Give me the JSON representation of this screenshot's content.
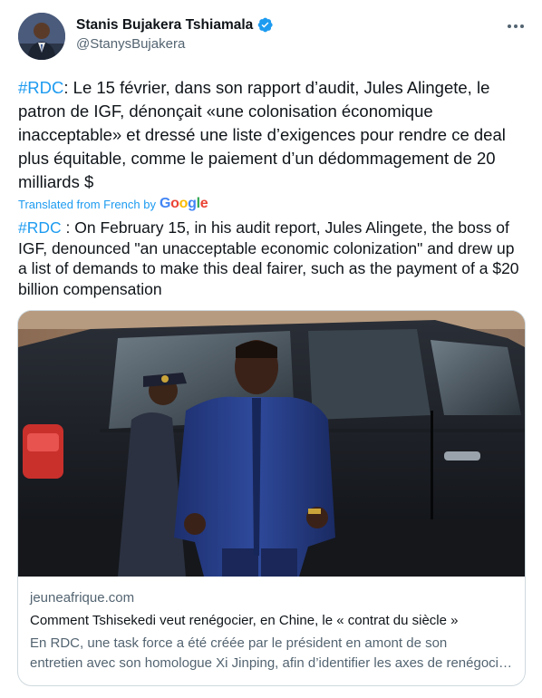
{
  "author": {
    "name": "Stanis Bujakera Tshiamala",
    "handle": "@StanysBujakera",
    "verified": true
  },
  "tweet": {
    "original_hashtag": "#RDC",
    "original_text": ": Le 15 février, dans son rapport d’audit, Jules Alingete, le patron de IGF, dénonçait «une colonisation économique inacceptable» et dressé une liste d’exigences pour rendre ce deal plus équitable, comme le paiement d’un dédommagement de 20 milliards $",
    "translated_label": "Translated from French by",
    "translator": "Google",
    "translation_hashtag": "#RDC",
    "translation_text": " : On February 15, in his audit report, Jules Alingete, the boss of IGF, denounced \"an unacceptable economic colonization\" and drew up a list of demands to make this deal fairer, such as the payment of a $20 billion compensation"
  },
  "card": {
    "domain": "jeuneafrique.com",
    "title": "Comment Tshisekedi veut renégocier, en Chine, le « contrat du siècle »",
    "description_line1": "En RDC, une task force a été créée par le président en amont de son",
    "description_line2": "entretien avec son homologue Xi Jinping, afin d’identifier les axes de renégociation"
  },
  "colors": {
    "accent": "#1d9bf0",
    "text": "#0f1419",
    "secondary": "#536471",
    "border": "#cfd9de"
  },
  "icons": [
    "verified-badge-icon",
    "more-options-icon"
  ]
}
